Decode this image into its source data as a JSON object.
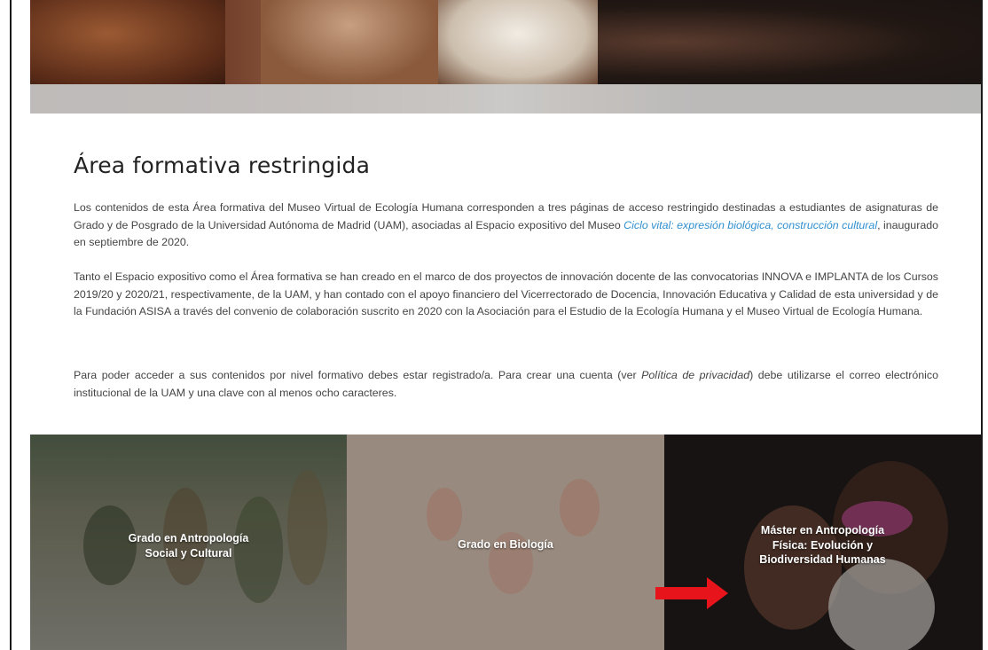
{
  "section": {
    "title": "Área formativa restringida"
  },
  "paragraphs": {
    "p1_a": "Los contenidos de esta Área formativa del Museo Virtual de Ecología Humana corresponden a tres páginas de acceso restringido destinadas a estudiantes de asignaturas de Grado y de Posgrado de la Universidad Autónoma de Madrid (UAM), asociadas al Espacio expositivo del Museo ",
    "p1_link": "Ciclo vital: expresión biológica, construcción cultural",
    "p1_b": ", inaugurado en septiembre de 2020.",
    "p2": "Tanto el Espacio expositivo como el Área formativa se han creado en el marco de dos proyectos de innovación docente de las convocatorias INNOVA e IMPLANTA de los Cursos 2019/20 y 2020/21, respectivamente, de la UAM, y han contado con el apoyo financiero del Vicerrectorado de Docencia, Innovación Educativa y Calidad de esta universidad y de la Fundación ASISA a través del convenio de colaboración suscrito en 2020 con la Asociación para el Estudio de la Ecología Humana y el Museo Virtual de Ecología Humana.",
    "p3_a": "Para poder acceder a sus contenidos por nivel formativo debes estar registrado/a. Para crear una cuenta (ver ",
    "p3_em": "Política de privacidad",
    "p3_b": ") debe utilizarse el correo electrónico institucional de la UAM y una clave con al menos ocho caracteres."
  },
  "tiles": [
    {
      "line1": "Grado en Antropología",
      "line2": "Social y Cultural"
    },
    {
      "line1": "Grado en Biología"
    },
    {
      "line1": "Máster en Antropología",
      "line2": "Física: Evolución y",
      "line3": "Biodiversidad Humanas"
    }
  ],
  "colors": {
    "link": "#2f8fcf",
    "arrow": "#e8141b"
  }
}
